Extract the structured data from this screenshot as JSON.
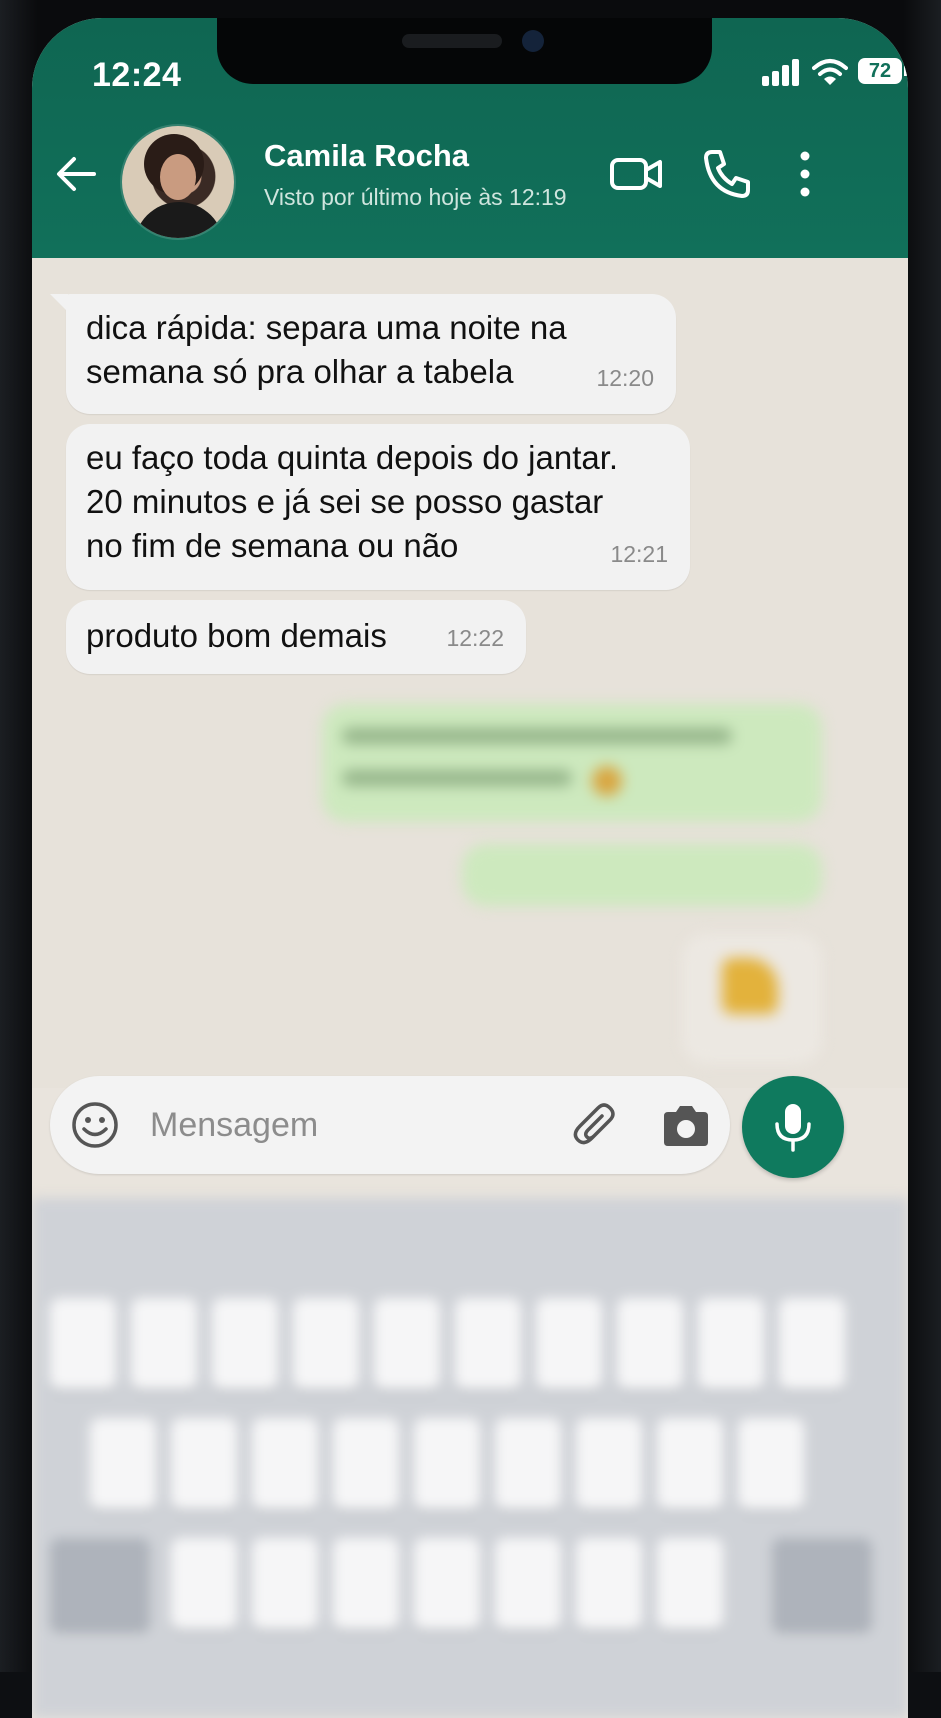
{
  "status_bar": {
    "time": "12:24",
    "battery": "72"
  },
  "header": {
    "contact_name": "Camila Rocha",
    "last_seen": "Visto por último hoje às 12:19"
  },
  "messages": [
    {
      "direction": "in",
      "text": "dica rápida: separa uma noite na\nsemana só pra olhar a tabela",
      "time": "12:20"
    },
    {
      "direction": "in",
      "text": "eu faço toda quinta depois do jantar.\n20 minutos e já sei se posso gastar\nno fim de semana ou não",
      "time": "12:21"
    },
    {
      "direction": "in",
      "text": "produto bom demais",
      "time": "12:22"
    }
  ],
  "composer": {
    "placeholder": "Mensagem"
  },
  "icons": [
    "back-arrow-icon",
    "video-call-icon",
    "phone-icon",
    "more-options-icon",
    "emoji-icon",
    "attach-icon",
    "camera-icon",
    "mic-icon"
  ],
  "colors": {
    "header": "#11705a",
    "accent": "#0f7a5e",
    "incoming_bubble": "#f2f2f2",
    "outgoing_bubble": "#cde9be"
  }
}
